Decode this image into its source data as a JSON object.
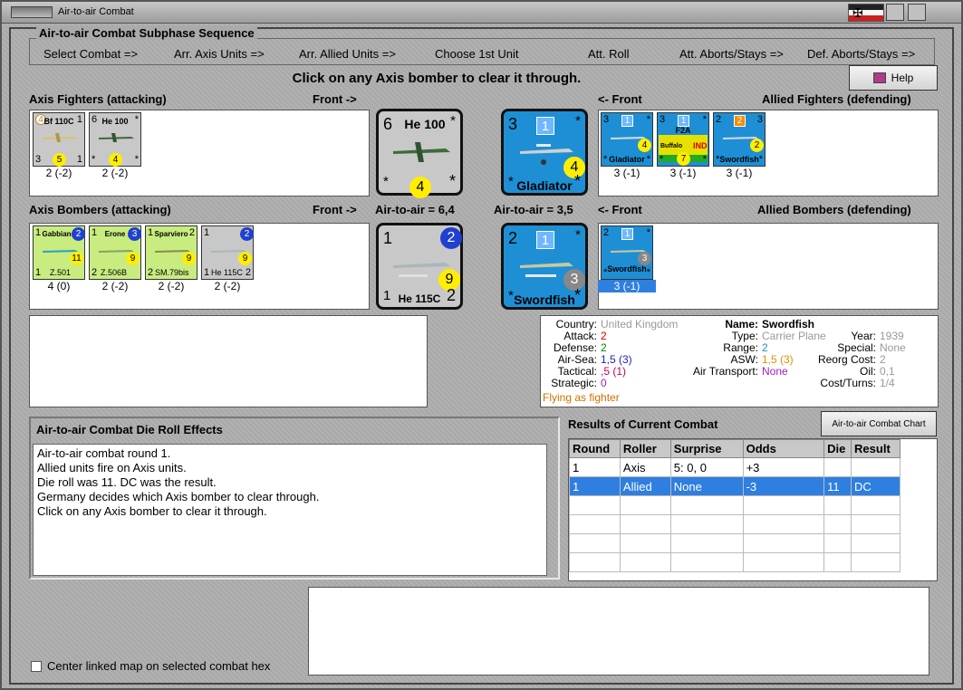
{
  "window": {
    "title": "Air-to-air Combat"
  },
  "flag_colors": [
    "#222222",
    "#f8f8f8",
    "#cc1f1f"
  ],
  "sequence": {
    "title": "Air-to-air Combat Subphase Sequence",
    "steps": [
      "Select Combat =>",
      "Arr. Axis Units =>",
      "Arr. Allied Units =>",
      "Choose 1st Unit",
      "Att. Roll",
      "Att. Aborts/Stays =>",
      "Def. Aborts/Stays =>"
    ]
  },
  "instruction": "Click on any Axis bomber to clear it through.",
  "help": {
    "label": "Help",
    "icon": "book-icon"
  },
  "labels": {
    "axis_fighters": "Axis Fighters (attacking)",
    "front_right": "Front ->",
    "front_left": "<- Front",
    "allied_fighters": "Allied Fighters (defending)",
    "axis_bombers": "Axis Bombers (attacking)",
    "air_to_air_axis": "Air-to-air = 6,4",
    "air_to_air_allied": "Air-to-air = 3,5",
    "allied_bombers": "Allied Bombers (defending)"
  },
  "axis_fighters": [
    {
      "name": "Bf 110C",
      "tl": "4",
      "tr": "1",
      "bl": "3",
      "br": "1",
      "circle": "5",
      "value": "2 (-2)"
    },
    {
      "name": "He 100",
      "tl": "6",
      "tr": "*",
      "bl": "*",
      "br": "*",
      "circle": "4",
      "value": "2 (-2)"
    }
  ],
  "allied_fighters": [
    {
      "name": "Gladiator",
      "tl": "3",
      "tr": "*",
      "bl": "*",
      "br": "*",
      "square": "1",
      "circle": "4",
      "value": "3 (-1)"
    },
    {
      "name": "F2A",
      "sub": "Buffalo",
      "tag": "IND",
      "tl": "3",
      "tr": "*",
      "bl": "*",
      "br": "*",
      "square": "1",
      "circle": "7",
      "value": "3 (-1)"
    },
    {
      "name": "Swordfish",
      "tl": "2",
      "tr": "3",
      "bl": "*",
      "br": "*",
      "square": "2",
      "circle": "2",
      "value": "3 (-1)"
    }
  ],
  "axis_bombers": [
    {
      "name": "Gabbiano",
      "code": "Z.501",
      "tl": "1",
      "tr": "2",
      "bl": "1",
      "br": "",
      "circle": "11",
      "value": "4 (0)"
    },
    {
      "name": "Erone",
      "code": "Z.506B",
      "tl": "1",
      "tr": "3",
      "bl": "2",
      "br": "",
      "circle": "9",
      "value": "2 (-2)"
    },
    {
      "name": "Sparviero",
      "code": "SM.79bis",
      "tl": "1",
      "tr": "2",
      "bl": "2",
      "br": "",
      "circle": "9",
      "value": "2 (-2)"
    },
    {
      "name": "",
      "code": "He 115C",
      "tl": "1",
      "tr": "2",
      "bl": "1",
      "br": "2",
      "circle": "9",
      "value": "2 (-2)"
    }
  ],
  "allied_bombers": [
    {
      "name": "Swordfish",
      "tl": "2",
      "tr": "*",
      "bl": "*",
      "br": "*",
      "square": "1",
      "circle": "3",
      "value": "3 (-1)"
    }
  ],
  "big_axis_fighter": {
    "name": "He 100",
    "tl": "6",
    "tr": "*",
    "bl": "*",
    "br": "*",
    "circle": "4"
  },
  "big_allied_fighter": {
    "name": "Gladiator",
    "tl": "3",
    "tr": "*",
    "bl": "*",
    "br": "*",
    "square": "1",
    "circle": "4"
  },
  "big_axis_bomber": {
    "name": "He 115C",
    "tl": "1",
    "tr": "2",
    "bl": "1",
    "br": "2",
    "circle": "9"
  },
  "big_allied_bomber": {
    "name": "Swordfish",
    "tl": "2",
    "tr": "*",
    "bl": "*",
    "br": "*",
    "square": "1",
    "circle": "3"
  },
  "unit_info": {
    "country_label": "Country:",
    "country": "United Kingdom",
    "attack_label": "Attack:",
    "attack": "2",
    "defense_label": "Defense:",
    "defense": "2",
    "airsea_label": "Air-Sea:",
    "airsea": "1,5 (3)",
    "tactical_label": "Tactical:",
    "tactical": ",5 (1)",
    "strategic_label": "Strategic:",
    "strategic": "0",
    "flying": "Flying as fighter",
    "name_label": "Name:",
    "name": "Swordfish",
    "type_label": "Type:",
    "type": "Carrier Plane",
    "range_label": "Range:",
    "range": "2",
    "asw_label": "ASW:",
    "asw": "1,5 (3)",
    "air_transport_label": "Air Transport:",
    "air_transport": "None",
    "year_label": "Year:",
    "year": "1939",
    "special_label": "Special:",
    "special": "None",
    "reorg_label": "Reorg Cost:",
    "reorg": "2",
    "oil_label": "Oil:",
    "oil": "0,1",
    "cost_label": "Cost/Turns:",
    "cost": "1/4"
  },
  "die_effects": {
    "title": "Air-to-air Combat Die Roll Effects",
    "lines": [
      "Air-to-air combat round 1.",
      "Allied units fire on Axis units.",
      "Die roll was 11.  DC was the result.",
      "Germany decides which Axis bomber to clear through.",
      "Click on any Axis bomber to clear it through."
    ]
  },
  "results": {
    "title": "Results of Current Combat",
    "chart_button": "Air-to-air Combat Chart",
    "headers": [
      "Round",
      "Roller",
      "Surprise",
      "Odds",
      "Die",
      "Result"
    ],
    "rows": [
      [
        "1",
        "Axis",
        "5: 0, 0",
        "+3",
        "",
        ""
      ],
      [
        "1",
        "Allied",
        "None",
        "-3",
        "11",
        "DC"
      ]
    ]
  },
  "center_checkbox": {
    "label": "Center linked map on selected combat hex",
    "checked": false
  }
}
